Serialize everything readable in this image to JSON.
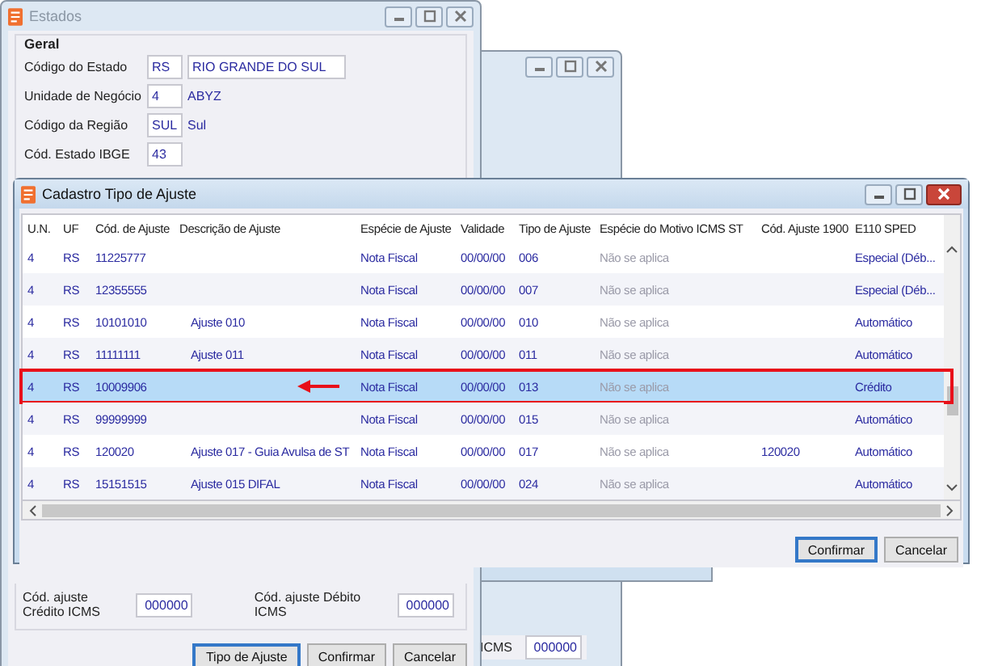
{
  "estados_window": {
    "title": "Estados",
    "group_title": "Geral",
    "fields": [
      {
        "label": "Código do Estado",
        "code": "RS",
        "value": "RIO GRANDE DO SUL",
        "kind": "input"
      },
      {
        "label": "Unidade de Negócio",
        "code": "4",
        "value": "ABYZ",
        "kind": "text"
      },
      {
        "label": "Código da Região",
        "code": "SUL",
        "value": "Sul",
        "kind": "text"
      },
      {
        "label": "Cód. Estado IBGE",
        "code": "43",
        "kind": "text"
      }
    ],
    "bottom_fields": [
      {
        "label": "Cód. ajuste Crédito ICMS",
        "value": "000000"
      },
      {
        "label": "Cód. ajuste Débito ICMS",
        "value": "000000"
      }
    ],
    "buttons": [
      {
        "label": "Tipo de Ajuste",
        "focused": true
      },
      {
        "label": "Confirmar",
        "focused": false
      },
      {
        "label": "Cancelar",
        "focused": false
      }
    ]
  },
  "back_window": {
    "field_label": "ICMS",
    "field_value": "000000"
  },
  "cadastro_window": {
    "title": "Cadastro Tipo de Ajuste",
    "columns": [
      "U.N.",
      "UF",
      "Cód. de Ajuste",
      "Descrição de Ajuste",
      "Espécie de Ajuste",
      "Validade",
      "Tipo de Ajuste",
      "Espécie do Motivo ICMS ST",
      "Cód. Ajuste 1900",
      "E110 SPED"
    ],
    "rows": [
      {
        "selected": false,
        "cells": [
          "4",
          "RS",
          "11225777",
          "",
          "Nota Fiscal",
          "00/00/00",
          "006",
          "Não se aplica",
          "",
          "Especial (Déb..."
        ]
      },
      {
        "selected": false,
        "cells": [
          "4",
          "RS",
          "12355555",
          "",
          "Nota Fiscal",
          "00/00/00",
          "007",
          "Não se aplica",
          "",
          "Especial (Déb..."
        ]
      },
      {
        "selected": false,
        "cells": [
          "4",
          "RS",
          "10101010",
          "Ajuste 010",
          "Nota Fiscal",
          "00/00/00",
          "010",
          "Não se aplica",
          "",
          "Automático"
        ]
      },
      {
        "selected": false,
        "cells": [
          "4",
          "RS",
          "11111111",
          "Ajuste 011",
          "Nota Fiscal",
          "00/00/00",
          "011",
          "Não se aplica",
          "",
          "Automático"
        ]
      },
      {
        "selected": true,
        "cells": [
          "4",
          "RS",
          "10009906",
          "",
          "Nota Fiscal",
          "00/00/00",
          "013",
          "Não se aplica",
          "",
          "Crédito"
        ]
      },
      {
        "selected": false,
        "cells": [
          "4",
          "RS",
          "99999999",
          "",
          "Nota Fiscal",
          "00/00/00",
          "015",
          "Não se aplica",
          "",
          "Automático"
        ]
      },
      {
        "selected": false,
        "cells": [
          "4",
          "RS",
          "120020",
          "Ajuste 017 - Guia Avulsa de ST",
          "Nota Fiscal",
          "00/00/00",
          "017",
          "Não se aplica",
          "120020",
          "Automático"
        ]
      },
      {
        "selected": false,
        "cells": [
          "4",
          "RS",
          "15151515",
          "Ajuste 015 DIFAL",
          "Nota Fiscal",
          "00/00/00",
          "024",
          "Não se aplica",
          "",
          "Automático"
        ]
      }
    ],
    "buttons": [
      {
        "label": "Confirmar",
        "focused": true
      },
      {
        "label": "Cancelar",
        "focused": false
      }
    ]
  }
}
